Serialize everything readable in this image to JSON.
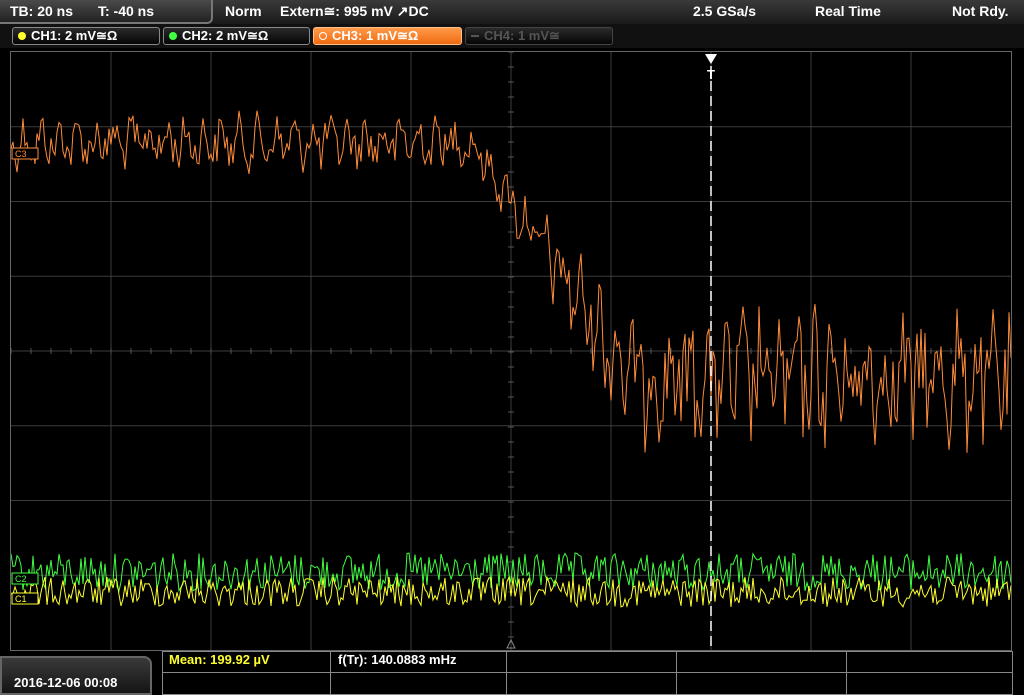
{
  "header": {
    "timebase": "TB: 20 ns",
    "trigger_time": "T: -40 ns",
    "mode": "Norm",
    "trigger_source": "Extern≅: 995 mV ↗DC",
    "sample_rate": "2.5 GSa/s",
    "acq_mode": "Real Time",
    "status": "Not Rdy."
  },
  "channels": [
    {
      "label": "CH1: 2 mV≅Ω",
      "color": "#ffff30",
      "state": "on"
    },
    {
      "label": "CH2: 2 mV≅Ω",
      "color": "#40ff40",
      "state": "on"
    },
    {
      "label": "CH3: 1 mV≅Ω",
      "color": "#ff8c3a",
      "state": "active"
    },
    {
      "label": "CH4: 1 mV≅",
      "color": "#555555",
      "state": "off"
    }
  ],
  "waveform_markers": {
    "ch3": "C3",
    "ch2": "C2",
    "ch1": "C1",
    "trigger": "T"
  },
  "footer": {
    "datetime": "2016-12-06 00:08",
    "measurement_1": "Mean: 199.92 µV",
    "measurement_2": "f(Tr): 140.0883 mHz"
  },
  "colors": {
    "ch1": "#ffff30",
    "ch2": "#40ff40",
    "ch3": "#ff8c3a",
    "grid": "#444444",
    "meas1": "#ffff30"
  }
}
